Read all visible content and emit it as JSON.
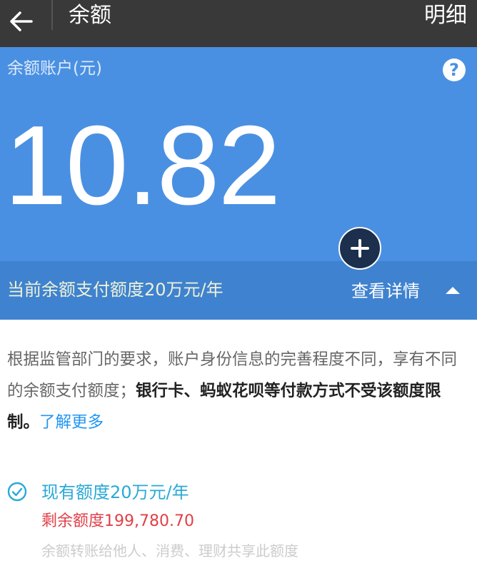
{
  "header": {
    "title": "余额",
    "detail_label": "明细"
  },
  "hero": {
    "account_label": "余额账户(元)",
    "help_glyph": "?",
    "balance": "10.82"
  },
  "strip": {
    "limit_text": "当前余额支付额度20万元/年",
    "view_details": "查看详情"
  },
  "description": {
    "normal": "根据监管部门的要求，账户身份信息的完善程度不同，享有不同的余额支付额度；",
    "bold": "银行卡、蚂蚁花呗等付款方式不受该额度限制。",
    "link": "了解更多"
  },
  "quota": {
    "current": "现有额度20万元/年",
    "remaining": "剩余额度199,780.70",
    "note": "余额转账给他人、消费、理财共享此额度"
  },
  "colors": {
    "header_bg": "#393939",
    "hero_bg": "#4a90e2",
    "strip_bg": "#3f82cf",
    "link": "#2196f3",
    "quota_current": "#2aa9d6",
    "quota_remaining": "#e04048"
  },
  "icons": [
    "back-arrow-icon",
    "help-icon",
    "plus-icon",
    "caret-up-icon",
    "check-circle-icon"
  ]
}
